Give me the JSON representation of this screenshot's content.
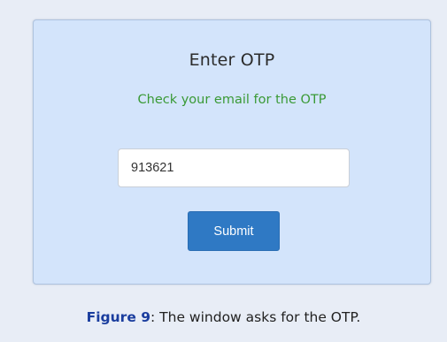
{
  "dialog": {
    "title": "Enter OTP",
    "subtitle": "Check your email for the OTP",
    "otp_value": "913621",
    "submit_label": "Submit"
  },
  "caption": {
    "label": "Figure 9",
    "text": ": The window asks for the OTP."
  },
  "colors": {
    "page_background": "#e8edf6",
    "panel_background": "#d3e4fb",
    "subtitle": "#3a9a36",
    "button": "#2f79c4",
    "caption_label": "#1a3d9e"
  }
}
